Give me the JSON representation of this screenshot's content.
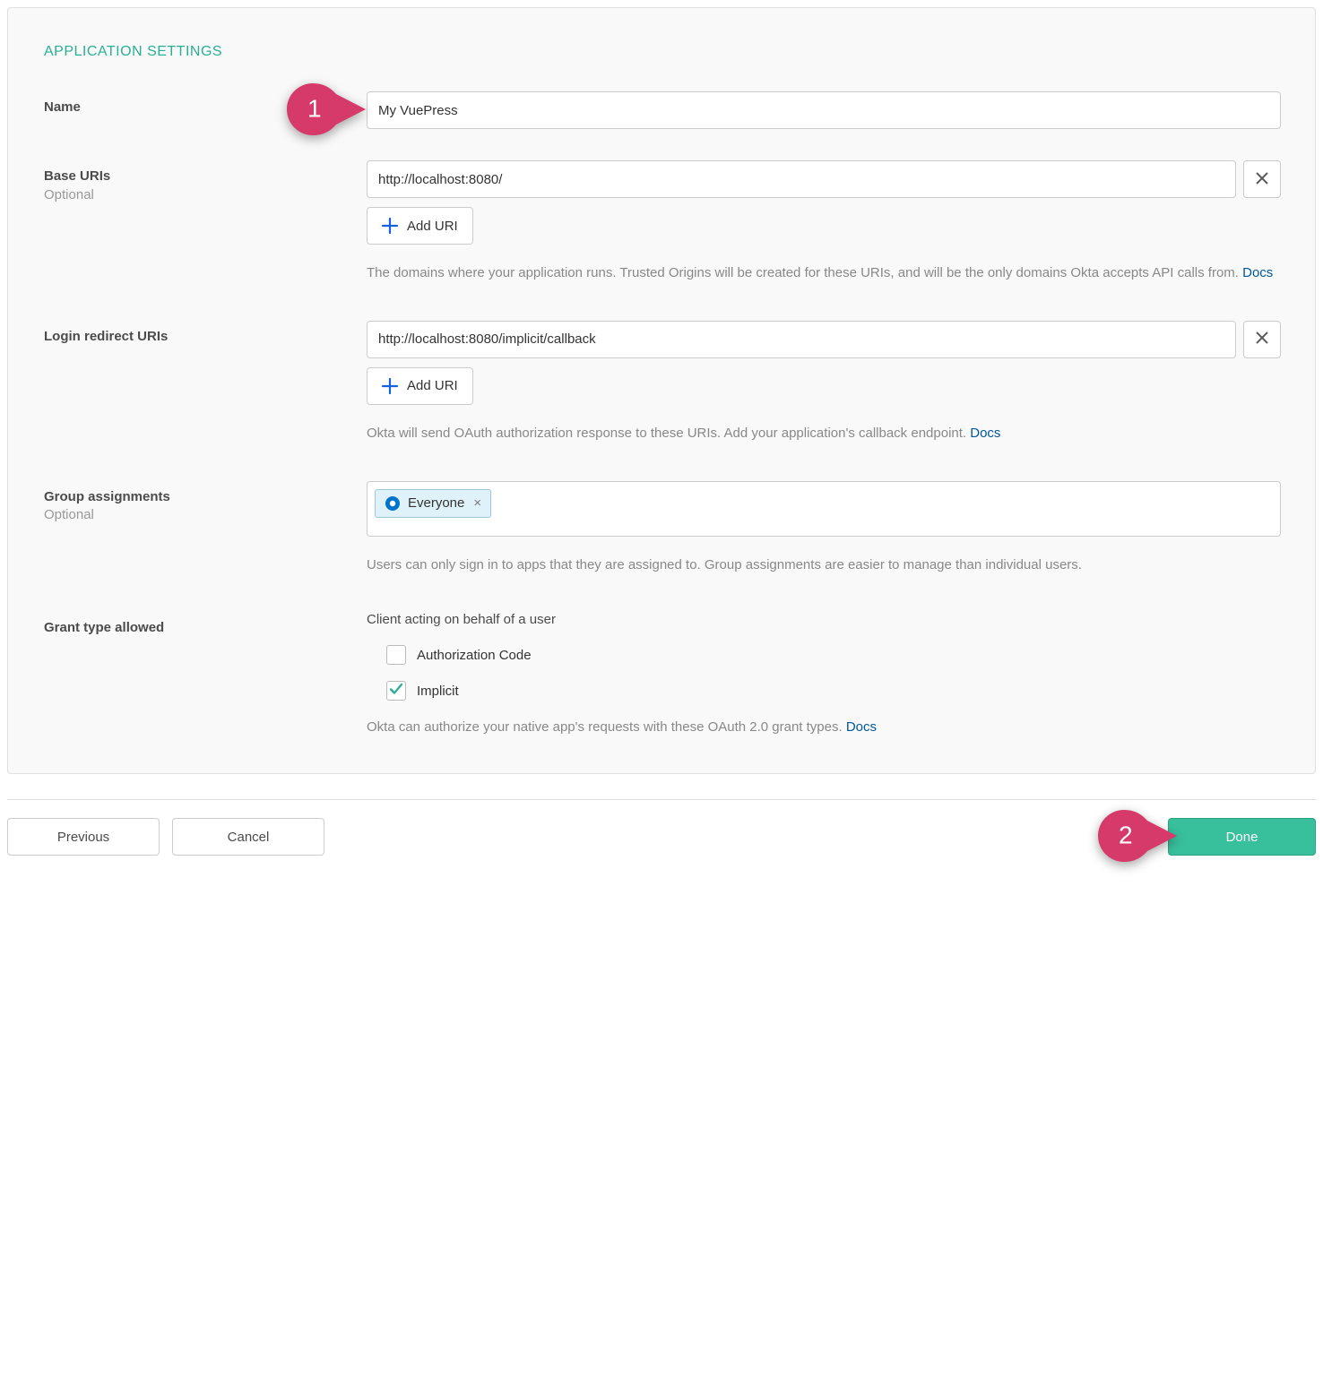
{
  "section_title": "APPLICATION SETTINGS",
  "name": {
    "label": "Name",
    "value": "My VuePress"
  },
  "base_uris": {
    "label": "Base URIs",
    "optional": "Optional",
    "value": "http://localhost:8080/",
    "add_label": "Add URI",
    "help_pre": "The domains where your application runs. Trusted Origins will be created for these URIs, and will be the only domains Okta accepts API calls from. ",
    "docs": "Docs"
  },
  "login_uris": {
    "label": "Login redirect URIs",
    "value": "http://localhost:8080/implicit/callback",
    "add_label": "Add URI",
    "help_pre": "Okta will send OAuth authorization response to these URIs. Add your application's callback endpoint. ",
    "docs": "Docs"
  },
  "group_assignments": {
    "label": "Group assignments",
    "optional": "Optional",
    "tag": "Everyone",
    "help": "Users can only sign in to apps that they are assigned to. Group assignments are easier to manage than individual users."
  },
  "grant_type": {
    "label": "Grant type allowed",
    "heading": "Client acting on behalf of a user",
    "opt_auth_code": "Authorization Code",
    "opt_implicit": "Implicit",
    "help_pre": "Okta can authorize your native app's requests with these OAuth 2.0 grant types. ",
    "docs": "Docs"
  },
  "footer": {
    "previous": "Previous",
    "cancel": "Cancel",
    "done": "Done"
  },
  "callouts": {
    "c1": "1",
    "c2": "2"
  }
}
